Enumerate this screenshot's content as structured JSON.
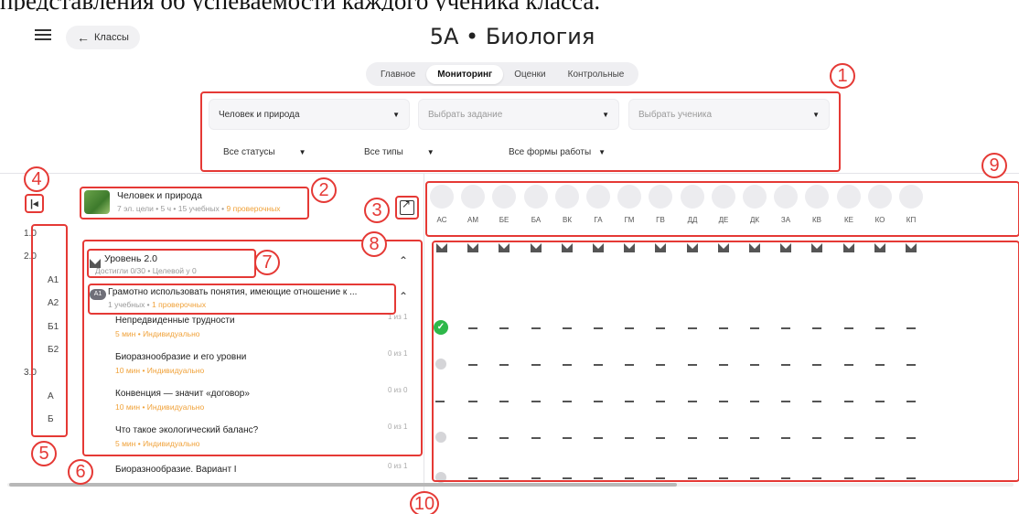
{
  "caption": "представления об успеваемости каждого ученика класса.",
  "header": {
    "back_label": "Классы",
    "title": "5А • Биология"
  },
  "tabs": [
    "Главное",
    "Мониторинг",
    "Оценки",
    "Контрольные"
  ],
  "active_tab": "Мониторинг",
  "filters": {
    "subject": "Человек и природа",
    "task_placeholder": "Выбрать задание",
    "student_placeholder": "Выбрать ученика",
    "statuses": "Все статусы",
    "types": "Все типы",
    "work_forms": "Все формы работы"
  },
  "subject_card": {
    "name": "Человек и природа",
    "meta_prefix": "7 эл. цели • 5 ч • 15 учебных • ",
    "meta_highlight": "9 проверочных"
  },
  "levels": [
    "1.0",
    "2.0",
    "А1",
    "А2",
    "Б1",
    "Б2",
    "3.0",
    "А",
    "Б"
  ],
  "level_block": {
    "title": "Уровень 2.0",
    "meta": "Достигли 0/30 • Целевой у 0"
  },
  "goal": {
    "badge": "А1",
    "title": "Грамотно использовать понятия, имеющие отношение к ...",
    "meta_prefix": "1 учебных • ",
    "meta_highlight": "1 проверочных"
  },
  "tasks": [
    {
      "name": "Непредвиденные трудности",
      "meta": "5 мин • Индивидуально",
      "count": "1 из 1"
    },
    {
      "name": "Биоразнообразие и его уровни",
      "meta": "10 мин • Индивидуально",
      "count": "0 из 1"
    },
    {
      "name": "Конвенция — значит «договор»",
      "meta": "10 мин • Индивидуально",
      "count": "0 из 0"
    },
    {
      "name": "Что такое экологический баланс?",
      "meta": "5 мин • Индивидуально",
      "count": "0 из 1"
    },
    {
      "name": "Биоразнообразие. Вариант I",
      "meta": "",
      "count": "0 из 1"
    }
  ],
  "students": [
    "АС",
    "АМ",
    "БЕ",
    "БА",
    "ВК",
    "ГА",
    "ГМ",
    "ГВ",
    "ДД",
    "ДЕ",
    "ДК",
    "ЗА",
    "КВ",
    "КЕ",
    "КО",
    "КП"
  ],
  "callouts": [
    "1",
    "2",
    "3",
    "4",
    "5",
    "6",
    "7",
    "8",
    "9",
    "10"
  ],
  "colors": {
    "callout": "#e53935",
    "accent_orange": "#f0a23a",
    "success": "#2eb84a"
  }
}
